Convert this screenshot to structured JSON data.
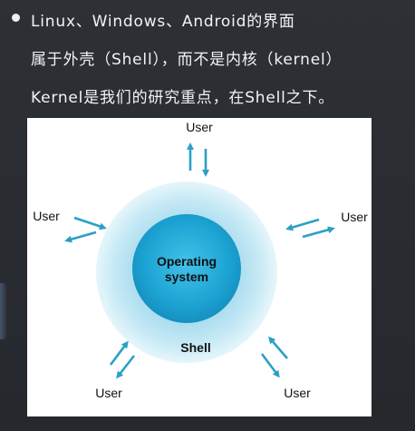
{
  "bullet": {
    "line1": "Linux、Windows、Android的界面",
    "line2": "属于外壳（Shell），而不是内核（kernel）",
    "line3": "Kernel是我们的研究重点，在Shell之下。"
  },
  "diagram": {
    "core_label_line1": "Operating",
    "core_label_line2": "system",
    "shell_label": "Shell",
    "users": {
      "top": "User",
      "left": "User",
      "right": "User",
      "bottom_left": "User",
      "bottom_right": "User"
    },
    "colors": {
      "outer_ring": "#cfeef6",
      "core": "#1fa8d6",
      "arrow": "#2aa0c6"
    }
  }
}
